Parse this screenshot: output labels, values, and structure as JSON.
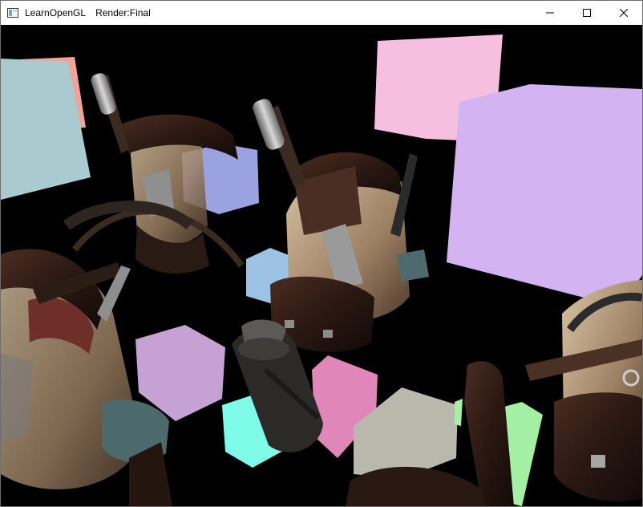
{
  "window": {
    "app_name": "LearnOpenGL",
    "render_label": "Render:Final",
    "icons": {
      "app": "window-app-icon",
      "minimize": "minimize-icon",
      "maximize": "maximize-icon",
      "close": "close-icon"
    }
  },
  "scene": {
    "background_color": "#000000",
    "light_cube_colors": {
      "teal": "#a9cbcf",
      "salmon": "#f0a39a",
      "pink": "#f6bfdf",
      "lavender": "#d3b3f2",
      "periwinkle": "#9aa3e0",
      "sky": "#9cc2e4",
      "mauve": "#c6a2d4",
      "aqua": "#7ffbe9",
      "magenta": "#e086b8",
      "gray": "#b8b8ac",
      "mint": "#a3f0a5"
    }
  }
}
